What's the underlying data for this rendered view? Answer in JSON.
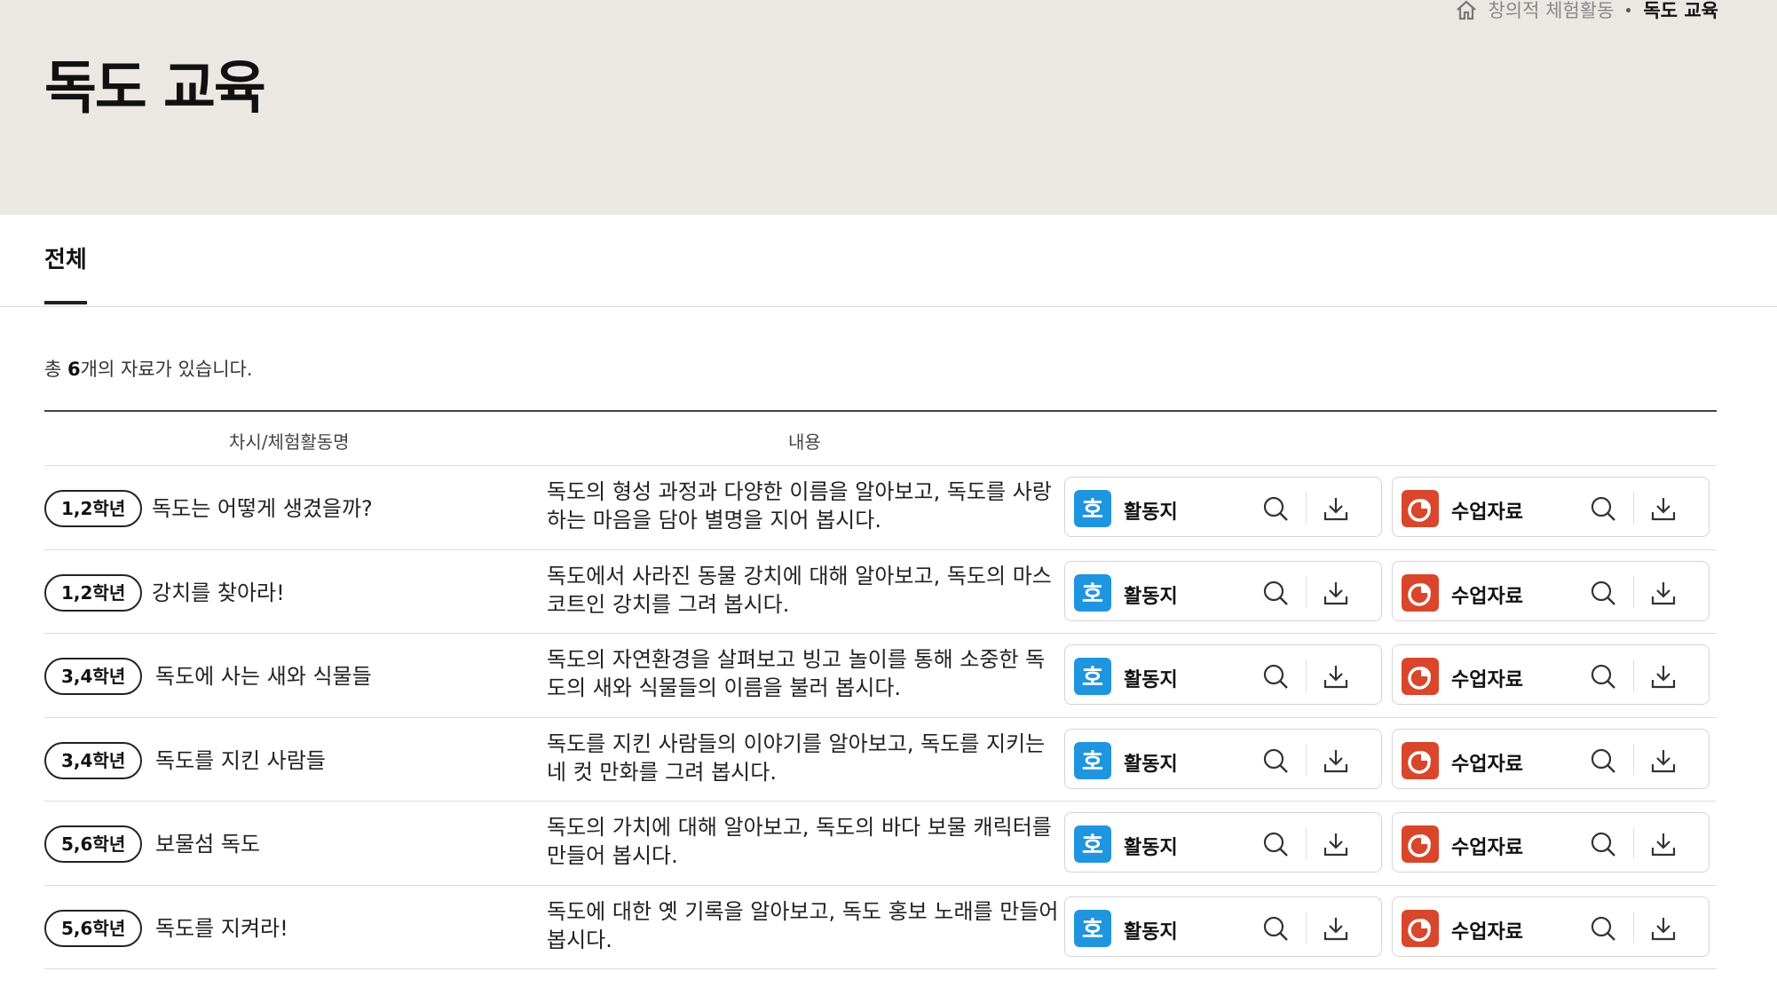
{
  "page": {
    "title": "독도 교육",
    "breadcrumb": [
      "창의적 체험활동",
      "독도 교육"
    ]
  },
  "tabs": [
    {
      "label": "전체",
      "active": true
    }
  ],
  "summary": {
    "prefix": "총 ",
    "count": "6",
    "suffix": "개의 자료가 있습니다."
  },
  "table": {
    "headers": [
      "차시/체험활동명",
      "내용"
    ],
    "rows": [
      {
        "grade": "1,2학년",
        "name": "독도는 어떻게 생겼을까?",
        "desc": "독도의 형성 과정과 다양한 이름을 알아보고, 독도를 사랑하는 마음을 담아 별명을 지어 봅시다."
      },
      {
        "grade": "1,2학년",
        "name": "강치를 찾아라!",
        "desc": "독도에서 사라진 동물 강치에 대해 알아보고, 독도의 마스코트인 강치를 그려 봅시다."
      },
      {
        "grade": "3,4학년",
        "name": "독도에 사는 새와 식물들",
        "desc": "독도의 자연환경을 살펴보고 빙고 놀이를 통해 소중한 독도의 새와 식물들의 이름을 불러 봅시다."
      },
      {
        "grade": "3,4학년",
        "name": "독도를 지킨 사람들",
        "desc": "독도를 지킨 사람들의 이야기를 알아보고, 독도를 지키는 네 컷 만화를 그려 봅시다."
      },
      {
        "grade": "5,6학년",
        "name": "보물섬 독도",
        "desc": "독도의 가치에 대해 알아보고, 독도의 바다 보물 캐릭터를 만들어 봅시다."
      },
      {
        "grade": "5,6학년",
        "name": "독도를 지켜라!",
        "desc": "독도에 대한 옛 기록을 알아보고, 독도 홍보 노래를 만들어 봅시다."
      }
    ]
  },
  "buttons": {
    "activity_label": "활동지",
    "material_label": "수업자료",
    "activity_icon": "hwp-icon",
    "material_icon": "ppt-icon",
    "activity_color": "#1f95e0",
    "material_color": "#d9462b"
  }
}
